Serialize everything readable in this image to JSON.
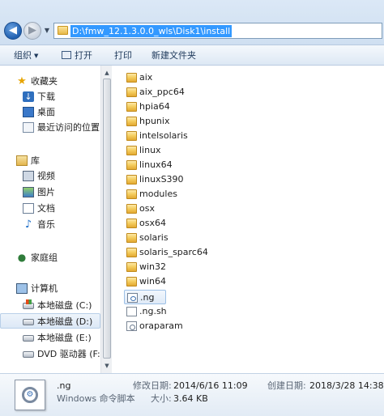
{
  "address": {
    "path": "D:\\fmw_12.1.3.0.0_wls\\Disk1\\install"
  },
  "toolbar": {
    "organize_label": "组织",
    "open_label": "打开",
    "print_label": "打印",
    "new_folder_label": "新建文件夹"
  },
  "nav": {
    "favorites_label": "收藏夹",
    "downloads_label": "下载",
    "desktop_label": "桌面",
    "recent_label": "最近访问的位置",
    "libraries_label": "库",
    "videos_label": "视频",
    "pictures_label": "图片",
    "documents_label": "文档",
    "music_label": "音乐",
    "homegroup_label": "家庭组",
    "computer_label": "计算机",
    "drive_c_label": "本地磁盘 (C:)",
    "drive_d_label": "本地磁盘 (D:)",
    "drive_e_label": "本地磁盘 (E:)",
    "drive_f_label": "DVD 驱动器 (F:)"
  },
  "files": [
    {
      "name": "aix",
      "type": "folder"
    },
    {
      "name": "aix_ppc64",
      "type": "folder"
    },
    {
      "name": "hpia64",
      "type": "folder"
    },
    {
      "name": "hpunix",
      "type": "folder"
    },
    {
      "name": "intelsolaris",
      "type": "folder"
    },
    {
      "name": "linux",
      "type": "folder"
    },
    {
      "name": "linux64",
      "type": "folder"
    },
    {
      "name": "linuxS390",
      "type": "folder"
    },
    {
      "name": "modules",
      "type": "folder"
    },
    {
      "name": "osx",
      "type": "folder"
    },
    {
      "name": "osx64",
      "type": "folder"
    },
    {
      "name": "solaris",
      "type": "folder"
    },
    {
      "name": "solaris_sparc64",
      "type": "folder"
    },
    {
      "name": "win32",
      "type": "folder"
    },
    {
      "name": "win64",
      "type": "folder"
    },
    {
      "name": ".ng",
      "type": "script"
    },
    {
      "name": ".ng.sh",
      "type": "file"
    },
    {
      "name": "oraparam",
      "type": "settings"
    }
  ],
  "details": {
    "file_name": ".ng",
    "file_type": "Windows 命令脚本",
    "modified_label": "修改日期:",
    "modified_value": "2014/6/16 11:09",
    "created_label": "创建日期:",
    "created_value": "2018/3/28 14:38",
    "size_label": "大小:",
    "size_value": "3.64 KB"
  },
  "icons": {
    "back": "back-arrow-icon",
    "forward": "forward-arrow-icon",
    "folder": "folder-icon",
    "script": "script-file-icon",
    "settings": "settings-file-icon"
  },
  "colors": {
    "selection_highlight": "#3399ff",
    "folder_yellow": "#f5cf62",
    "chrome_blue": "#dbe8f6"
  }
}
